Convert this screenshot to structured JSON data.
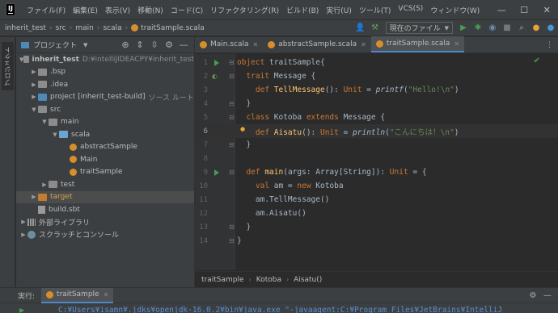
{
  "menubar": {
    "items": [
      "ファイル(F)",
      "編集(E)",
      "表示(V)",
      "移動(N)",
      "コード(C)",
      "リファクタリング(R)",
      "ビルド(B)",
      "実行(U)",
      "ツール(T)",
      "VCS(S)",
      "ウィンドウ(W)"
    ],
    "window_title": "inherit_te",
    "controls": [
      "minimize-icon",
      "maximize-icon",
      "close-icon"
    ]
  },
  "navbar": {
    "breadcrumbs": [
      "inherit_test",
      "src",
      "main",
      "scala",
      "traitSample.scala"
    ],
    "run_config": "現在のファイル"
  },
  "left_strip": {
    "project_tab": "プロジェクト"
  },
  "project_panel": {
    "title": "プロジェクト",
    "tree": [
      {
        "label": "inherit_test",
        "extra": "D:¥intelliJIDEACPY¥inherit_test",
        "depth": 0,
        "icon": "folder",
        "expanded": true,
        "bold": true
      },
      {
        "label": ".bsp",
        "depth": 1,
        "icon": "folder",
        "expanded": false
      },
      {
        "label": ".idea",
        "depth": 1,
        "icon": "folder",
        "expanded": false
      },
      {
        "label": "project [inherit_test-build]",
        "extra": "ソース ルート",
        "depth": 1,
        "icon": "folder-blue",
        "expanded": false
      },
      {
        "label": "src",
        "depth": 1,
        "icon": "folder",
        "expanded": true
      },
      {
        "label": "main",
        "depth": 2,
        "icon": "folder",
        "expanded": true
      },
      {
        "label": "scala",
        "depth": 3,
        "icon": "folder-src",
        "expanded": true
      },
      {
        "label": "abstractSample",
        "depth": 4,
        "icon": "scala"
      },
      {
        "label": "Main",
        "depth": 4,
        "icon": "scala"
      },
      {
        "label": "traitSample",
        "depth": 4,
        "icon": "scala"
      },
      {
        "label": "test",
        "depth": 2,
        "icon": "folder",
        "expanded": false
      },
      {
        "label": "target",
        "depth": 1,
        "icon": "folder-orange",
        "expanded": false,
        "selected": true,
        "orange": true
      },
      {
        "label": "build.sbt",
        "depth": 1,
        "icon": "sbt"
      },
      {
        "label": "外部ライブラリ",
        "depth": 0,
        "icon": "lib",
        "expanded": false
      },
      {
        "label": "スクラッチとコンソール",
        "depth": 0,
        "icon": "scratch",
        "expanded": false
      }
    ]
  },
  "editor": {
    "tabs": [
      {
        "label": "Main.scala",
        "active": false
      },
      {
        "label": "abstractSample.scala",
        "active": false
      },
      {
        "label": "traitSample.scala",
        "active": true
      }
    ],
    "lines": [
      {
        "n": "1",
        "tokens": [
          [
            "kw",
            "object "
          ],
          [
            "ty",
            "traitSample{"
          ]
        ]
      },
      {
        "n": "2",
        "tokens": [
          [
            "kw",
            "  trait "
          ],
          [
            "ty",
            "Message {"
          ]
        ]
      },
      {
        "n": "3",
        "tokens": [
          [
            "kw",
            "    def "
          ],
          [
            "fn",
            "TellMessage"
          ],
          [
            "ty",
            "(): "
          ],
          [
            "kw",
            "Unit "
          ],
          [
            "ty",
            "= "
          ],
          [
            "it",
            "printf"
          ],
          [
            "ty",
            "("
          ],
          [
            "str",
            "\"Hello!\\n\""
          ],
          [
            "ty",
            ")"
          ]
        ]
      },
      {
        "n": "4",
        "tokens": [
          [
            "ty",
            "  }"
          ]
        ]
      },
      {
        "n": "5",
        "tokens": [
          [
            "kw",
            "  class "
          ],
          [
            "ty",
            "Kotoba "
          ],
          [
            "kw",
            "extends "
          ],
          [
            "ty",
            "Message {"
          ]
        ]
      },
      {
        "n": "6",
        "tokens": [
          [
            "kw",
            "    def "
          ],
          [
            "fn",
            "Aisatu"
          ],
          [
            "ty",
            "(): "
          ],
          [
            "kw",
            "Unit "
          ],
          [
            "ty",
            "= "
          ],
          [
            "it",
            "println"
          ],
          [
            "ty",
            "("
          ],
          [
            "str",
            "\"こんにちは！\\n\""
          ],
          [
            "ty",
            ")"
          ]
        ]
      },
      {
        "n": "7",
        "tokens": [
          [
            "ty",
            "  }"
          ]
        ]
      },
      {
        "n": "8",
        "tokens": []
      },
      {
        "n": "9",
        "tokens": [
          [
            "kw",
            "  def "
          ],
          [
            "fn",
            "main"
          ],
          [
            "ty",
            "(args: Array[String]): "
          ],
          [
            "kw",
            "Unit "
          ],
          [
            "ty",
            "= {"
          ]
        ]
      },
      {
        "n": "10",
        "tokens": [
          [
            "kw",
            "    val "
          ],
          [
            "ty",
            "am = "
          ],
          [
            "kw",
            "new "
          ],
          [
            "ty",
            "Kotoba"
          ]
        ]
      },
      {
        "n": "11",
        "tokens": [
          [
            "ty",
            "    am.TellMessage()"
          ]
        ]
      },
      {
        "n": "12",
        "tokens": [
          [
            "ty",
            "    am.Aisatu()"
          ]
        ]
      },
      {
        "n": "13",
        "tokens": [
          [
            "ty",
            "  }"
          ]
        ]
      },
      {
        "n": "14",
        "tokens": [
          [
            "ty",
            "}"
          ]
        ]
      }
    ],
    "current_line": "6",
    "bottom_breadcrumb": [
      "traitSample",
      "Kotoba",
      "Aisatu()"
    ]
  },
  "run_window": {
    "label": "実行:",
    "tab": "traitSample",
    "console_line": "C:¥Users¥isamn¥.jdks¥openjdk-16.0.2¥bin¥java.exe \"-javaagent:C:¥Program Files¥JetBrains¥IntelliJ"
  },
  "colors": {
    "accent": "#4a88c7",
    "run_green": "#499c54",
    "scala_icon": "#d68f2b"
  }
}
